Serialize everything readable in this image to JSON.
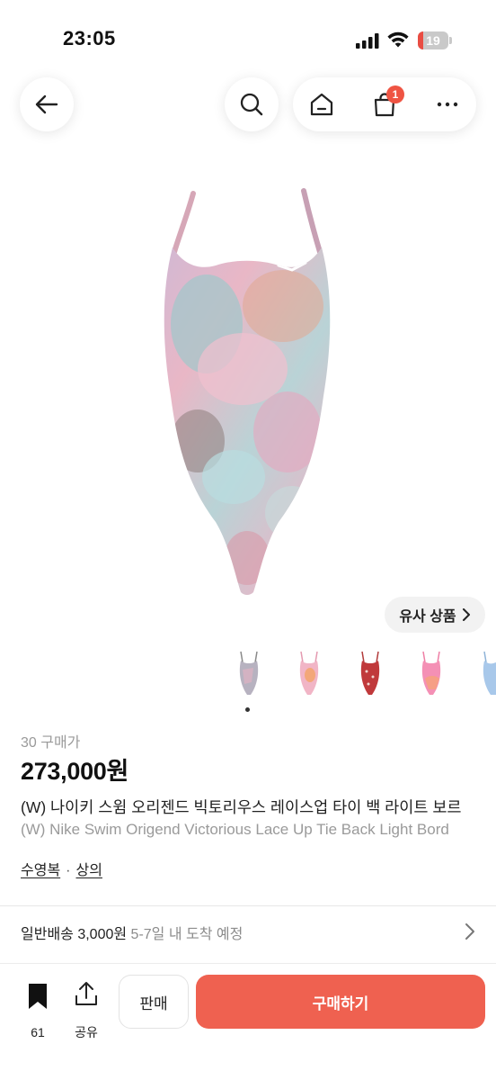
{
  "status_bar": {
    "time": "23:05",
    "battery": "19",
    "battery_level": 0.19
  },
  "badges": {
    "cart_count": "1"
  },
  "similar": {
    "label": "유사 상품"
  },
  "product": {
    "purchase_count": "30 구매가",
    "price": "273,000원",
    "title_ko": "(W) 나이키 스윔 오리젠드 빅토리우스 레이스업 타이 백 라이트 보르",
    "title_en": "(W) Nike Swim Origend Victorious Lace Up Tie Back Light Bord",
    "categories": [
      "수영복",
      "상의"
    ],
    "category_separator": "·"
  },
  "shipping": {
    "label": "일반배송 3,000원",
    "eta": "5-7일 내 도착 예정"
  },
  "bottom_bar": {
    "bookmark_count": "61",
    "share_label": "공유",
    "sell_label": "판매",
    "buy_label": "구매하기"
  },
  "colors": {
    "accent": "#ef6150",
    "badge": "#ef5443",
    "battery_low": "#e94d43"
  },
  "icons": [
    "back-arrow-icon",
    "search-icon",
    "home-icon",
    "shopping-bag-icon",
    "more-icon",
    "chevron-right-icon",
    "bookmark-icon",
    "share-icon"
  ],
  "thumbnails": [
    "floral-pastel",
    "pink-orange",
    "red-pattern",
    "pink-gradient",
    "blue-pastel"
  ]
}
